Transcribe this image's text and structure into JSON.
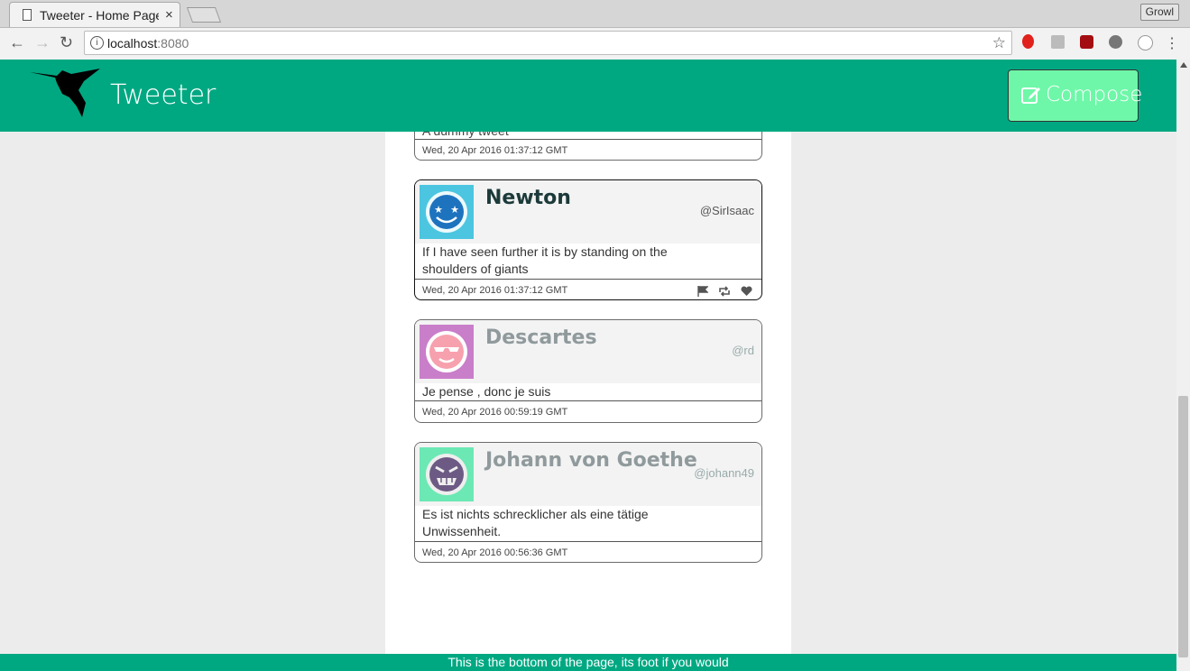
{
  "browser": {
    "tab_title": "Tweeter - Home Page",
    "close_glyph": "×",
    "url_host": "localhost",
    "url_port": ":8080",
    "profile_name": "Growl"
  },
  "app": {
    "brand": "Tweeter",
    "compose_label": "Compose",
    "accent_color": "#00a882",
    "compose_color": "#6ef7a8"
  },
  "partial_tweet": {
    "body": "A dummy tweet",
    "timestamp": "Wed, 20 Apr 2016 01:37:12 GMT"
  },
  "tweets": [
    {
      "author": "Newton",
      "handle": "@SirIsaac",
      "body": "If I have seen further it is by standing on the shoulders of giants",
      "timestamp": "Wed, 20 Apr 2016 01:37:12 GMT",
      "avatar_color": "#4cc6e0"
    },
    {
      "author": "Descartes",
      "handle": "@rd",
      "body": "Je pense , donc je suis",
      "timestamp": "Wed, 20 Apr 2016 00:59:19 GMT",
      "avatar_color": "#c97ec9"
    },
    {
      "author": "Johann von Goethe",
      "handle": "@johann49",
      "body": "Es ist nichts schrecklicher als eine tätige Unwissenheit.",
      "timestamp": "Wed, 20 Apr 2016 00:56:36 GMT",
      "avatar_color": "#6be8b4"
    }
  ],
  "footer": {
    "text": "This is the bottom of the page, its foot if you would"
  }
}
